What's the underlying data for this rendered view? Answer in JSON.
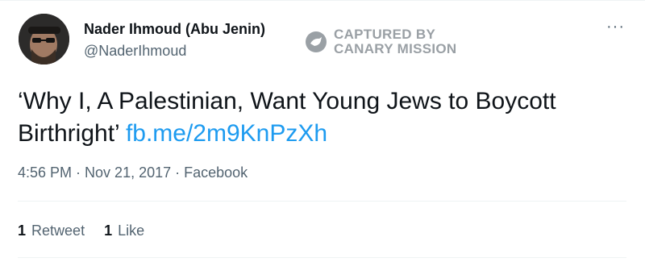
{
  "author": {
    "name": "Nader Ihmoud (Abu Jenin)",
    "handle": "@NaderIhmoud"
  },
  "watermark": {
    "line1": "CAPTURED BY",
    "line2": "CANARY MISSION"
  },
  "more_icon": "more-horizontal-icon",
  "tweet": {
    "text": "‘Why I, A Palestinian, Want Young Jews to Boycott Birthright’ ",
    "link": "fb.me/2m9KnPzXh"
  },
  "meta": {
    "time": "4:56 PM",
    "separator": " · ",
    "date": "Nov 21, 2017",
    "source": "Facebook"
  },
  "stats": {
    "retweets_count": "1",
    "retweets_label": "Retweet",
    "likes_count": "1",
    "likes_label": "Like"
  },
  "colors": {
    "link": "#1d9bf0",
    "secondary_text": "#536471",
    "divider": "#eff3f4"
  }
}
